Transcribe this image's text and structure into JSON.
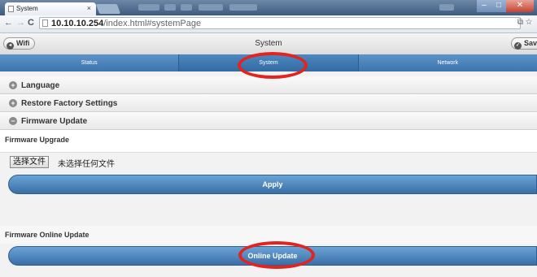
{
  "browser": {
    "tab_title": "System",
    "tab_close": "×",
    "url_host": "10.10.10.254",
    "url_path": "/index.html#systemPage",
    "back": "←",
    "forward": "→",
    "reload": "C"
  },
  "header": {
    "left_button": "Wifi",
    "title": "System",
    "right_button": "Save"
  },
  "nav": {
    "tabs": [
      {
        "label": "Status"
      },
      {
        "label": "System"
      },
      {
        "label": "Network"
      }
    ]
  },
  "sections": [
    {
      "label": "Language",
      "icon": "+"
    },
    {
      "label": "Restore Factory Settings",
      "icon": "+"
    },
    {
      "label": "Firmware Update",
      "icon": "−"
    }
  ],
  "firmware": {
    "upgrade_label": "Firmware Upgrade",
    "file_button": "选择文件",
    "file_status": "未选择任何文件",
    "apply_button": "Apply",
    "online_label": "Firmware Online Update",
    "online_button": "Online Update"
  },
  "colors": {
    "nav_blue": "#3d74ad",
    "annotation_red": "#e2231f"
  }
}
